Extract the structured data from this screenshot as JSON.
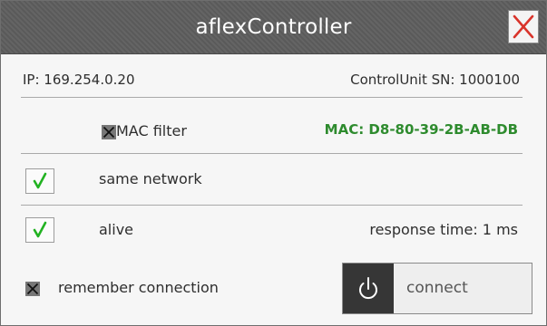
{
  "window": {
    "title": "aflexController"
  },
  "info": {
    "ip": "IP: 169.254.0.20",
    "serial": "ControlUnit SN: 1000100"
  },
  "mac_filter": {
    "label": "MAC filter",
    "address": "MAC: D8-80-39-2B-AB-DB",
    "checked": false
  },
  "same_network": {
    "label": "same network",
    "checked": true
  },
  "alive": {
    "label": "alive",
    "checked": true,
    "response_time": "response time: 1 ms"
  },
  "remember": {
    "label": "remember connection",
    "checked": false
  },
  "connect": {
    "label": "connect"
  },
  "colors": {
    "titlebar": "#5e5e5e",
    "close_x": "#d9342b",
    "check_green": "#22b222",
    "mac_green": "#2e8b2e"
  },
  "icons": {
    "close": "close-icon",
    "check": "checkmark-icon",
    "x_box": "x-box-icon",
    "power": "power-icon"
  }
}
